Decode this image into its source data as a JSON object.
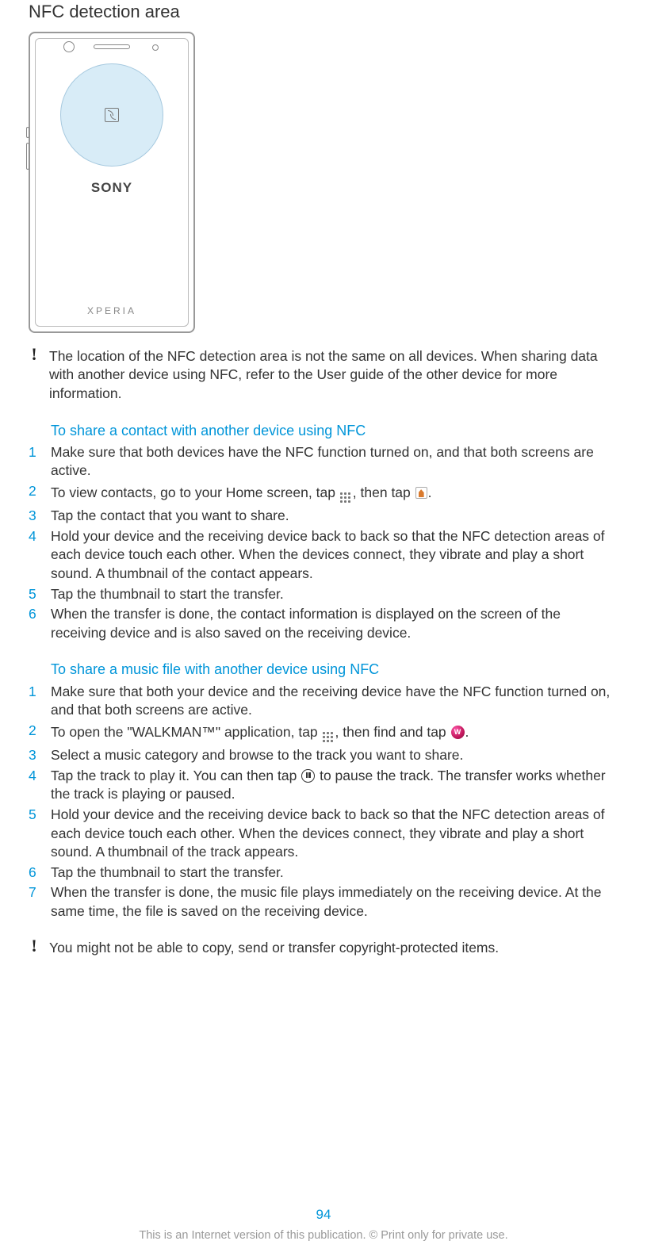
{
  "heading": "NFC detection area",
  "device": {
    "brand_top": "SONY",
    "brand_bottom": "XPERIA"
  },
  "note1": "The location of the NFC detection area is not the same on all devices. When sharing data with another device using NFC, refer to the User guide of the other device for more information.",
  "section_contact": {
    "title": "To share a contact with another device using NFC",
    "steps": {
      "s1": "Make sure that both devices have the NFC function turned on, and that both screens are active.",
      "s2a": "To view contacts, go to your Home screen, tap ",
      "s2b": ", then tap ",
      "s2c": ".",
      "s3": "Tap the contact that you want to share.",
      "s4": "Hold your device and the receiving device back to back so that the NFC detection areas of each device touch each other. When the devices connect, they vibrate and play a short sound. A thumbnail of the contact appears.",
      "s5": "Tap the thumbnail to start the transfer.",
      "s6": "When the transfer is done, the contact information is displayed on the screen of the receiving device and is also saved on the receiving device."
    }
  },
  "section_music": {
    "title": "To share a music file with another device using NFC",
    "steps": {
      "s1": "Make sure that both your device and the receiving device have the NFC function turned on, and that both screens are active.",
      "s2a": "To open the \"WALKMAN™\" application, tap ",
      "s2b": ", then find and tap ",
      "s2c": ".",
      "s3": "Select a music category and browse to the track you want to share.",
      "s4a": "Tap the track to play it. You can then tap ",
      "s4b": " to pause the track. The transfer works whether the track is playing or paused.",
      "s5": "Hold your device and the receiving device back to back so that the NFC detection areas of each device touch each other. When the devices connect, they vibrate and play a short sound. A thumbnail of the track appears.",
      "s6": "Tap the thumbnail to start the transfer.",
      "s7": "When the transfer is done, the music file plays immediately on the receiving device. At the same time, the file is saved on the receiving device."
    }
  },
  "note2": "You might not be able to copy, send or transfer copyright-protected items.",
  "footer": {
    "page": "94",
    "disclaimer": "This is an Internet version of this publication. © Print only for private use."
  }
}
